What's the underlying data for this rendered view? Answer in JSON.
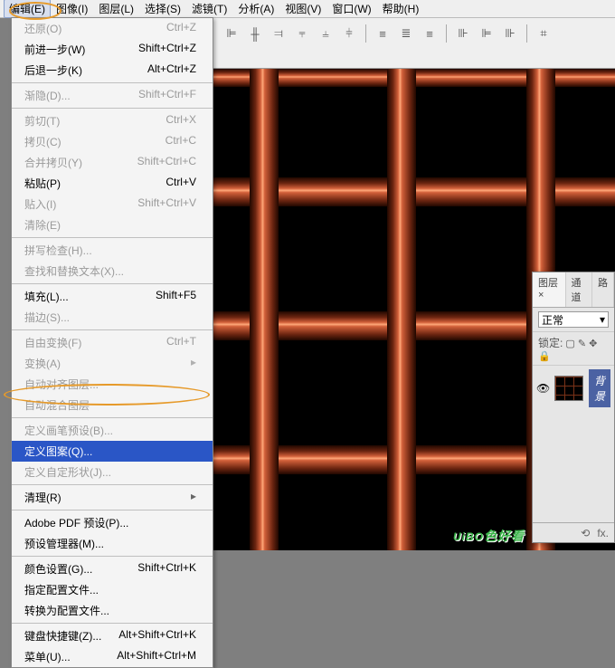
{
  "menubar": {
    "items": [
      {
        "label": "编辑(E)",
        "active": true
      },
      {
        "label": "图像(I)"
      },
      {
        "label": "图层(L)"
      },
      {
        "label": "选择(S)"
      },
      {
        "label": "滤镜(T)"
      },
      {
        "label": "分析(A)"
      },
      {
        "label": "视图(V)"
      },
      {
        "label": "窗口(W)"
      },
      {
        "label": "帮助(H)"
      }
    ]
  },
  "dropdown": {
    "groups": [
      [
        {
          "label": "还原(O)",
          "shortcut": "Ctrl+Z",
          "disabled": true
        },
        {
          "label": "前进一步(W)",
          "shortcut": "Shift+Ctrl+Z"
        },
        {
          "label": "后退一步(K)",
          "shortcut": "Alt+Ctrl+Z"
        }
      ],
      [
        {
          "label": "渐隐(D)...",
          "shortcut": "Shift+Ctrl+F",
          "disabled": true
        }
      ],
      [
        {
          "label": "剪切(T)",
          "shortcut": "Ctrl+X",
          "disabled": true
        },
        {
          "label": "拷贝(C)",
          "shortcut": "Ctrl+C",
          "disabled": true
        },
        {
          "label": "合并拷贝(Y)",
          "shortcut": "Shift+Ctrl+C",
          "disabled": true
        },
        {
          "label": "粘贴(P)",
          "shortcut": "Ctrl+V"
        },
        {
          "label": "贴入(I)",
          "shortcut": "Shift+Ctrl+V",
          "disabled": true
        },
        {
          "label": "清除(E)",
          "disabled": true
        }
      ],
      [
        {
          "label": "拼写检查(H)...",
          "disabled": true
        },
        {
          "label": "查找和替换文本(X)...",
          "disabled": true
        }
      ],
      [
        {
          "label": "填充(L)...",
          "shortcut": "Shift+F5"
        },
        {
          "label": "描边(S)...",
          "disabled": true
        }
      ],
      [
        {
          "label": "自由变换(F)",
          "shortcut": "Ctrl+T",
          "disabled": true
        },
        {
          "label": "变换(A)",
          "arrow": true,
          "disabled": true
        },
        {
          "label": "自动对齐图层...",
          "disabled": true
        },
        {
          "label": "自动混合图层",
          "disabled": true
        }
      ],
      [
        {
          "label": "定义画笔预设(B)...",
          "disabled": true
        },
        {
          "label": "定义图案(Q)...",
          "hi": true
        },
        {
          "label": "定义自定形状(J)...",
          "disabled": true
        }
      ],
      [
        {
          "label": "清理(R)",
          "arrow": true
        }
      ],
      [
        {
          "label": "Adobe PDF 预设(P)..."
        },
        {
          "label": "预设管理器(M)..."
        }
      ],
      [
        {
          "label": "颜色设置(G)...",
          "shortcut": "Shift+Ctrl+K"
        },
        {
          "label": "指定配置文件..."
        },
        {
          "label": "转换为配置文件..."
        }
      ],
      [
        {
          "label": "键盘快捷键(Z)...",
          "shortcut": "Alt+Shift+Ctrl+K"
        },
        {
          "label": "菜单(U)...",
          "shortcut": "Alt+Shift+Ctrl+M"
        }
      ]
    ]
  },
  "panel": {
    "tabs": [
      {
        "label": "图层",
        "active": true
      },
      {
        "label": "通道"
      },
      {
        "label": "路"
      }
    ],
    "mode": "正常",
    "lock_label": "锁定:",
    "layer_name": "背景",
    "eye": "👁",
    "status_icons": {
      "link": "⟲",
      "fx": "fx."
    }
  },
  "watermark": {
    "brand": "UiBO",
    "suffix": "色好看"
  }
}
